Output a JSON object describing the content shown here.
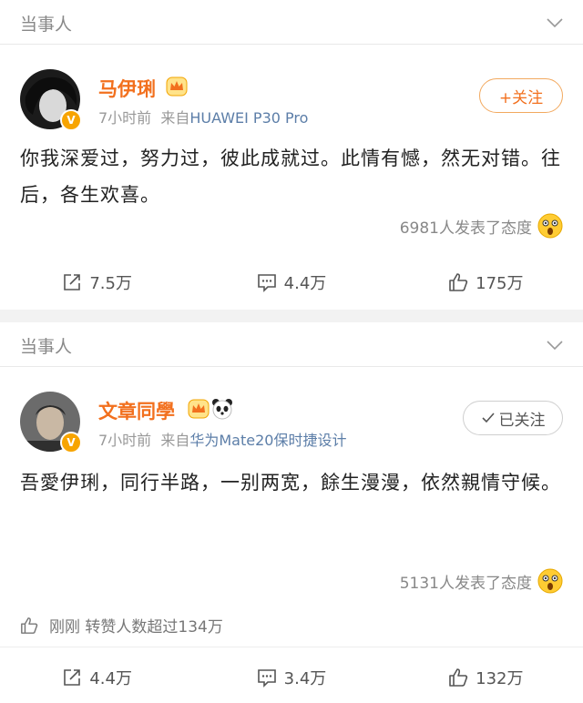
{
  "post1": {
    "header": "当事人",
    "name": "马伊琍",
    "time": "7小时前",
    "source_prefix": "来自",
    "source": "HUAWEI P30 Pro",
    "follow_label": "+关注",
    "content": "你我深爱过，努力过，彼此成就过。此情有憾，然无对错。往后，各生欢喜。",
    "reactions": "6981人发表了态度",
    "repost": "7.5万",
    "comment": "4.4万",
    "like": "175万"
  },
  "post2": {
    "header": "当事人",
    "name": "文章同學",
    "time": "7小时前",
    "source_prefix": "来自",
    "source": "华为Mate20保时捷设计",
    "follow_label": "已关注",
    "content": "吾愛伊琍，同行半路，一别两宽，餘生漫漫，依然親情守候。",
    "reactions": "5131人发表了态度",
    "like_note": "刚刚 转赞人数超过134万",
    "repost": "4.4万",
    "comment": "3.4万",
    "like": "132万"
  },
  "colors": {
    "accent": "#f2701e",
    "verified": "#f7a400",
    "link": "#5c7ea8"
  },
  "icons": [
    "chevron-down-icon",
    "crown-badge-icon",
    "panda-icon",
    "verified-icon",
    "repost-icon",
    "comment-icon",
    "like-icon",
    "surprised-emoji-icon",
    "check-icon"
  ]
}
